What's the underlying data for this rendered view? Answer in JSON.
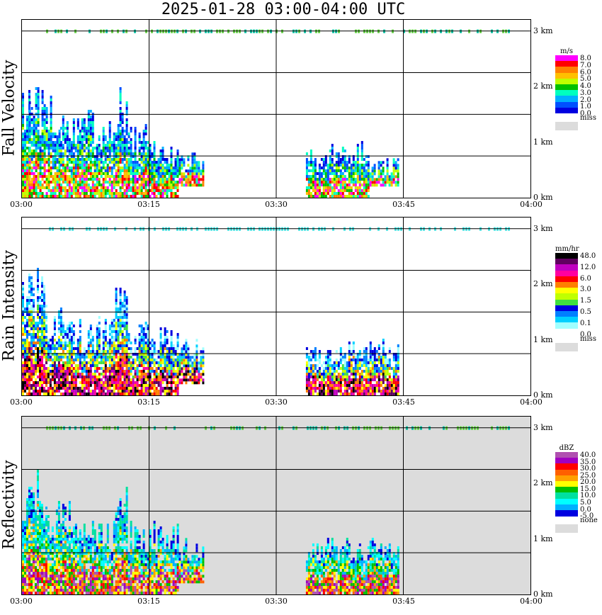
{
  "title": "2025-01-28   03:00-04:00 UTC",
  "chart_data": [
    {
      "type": "heatmap",
      "ylabel": "Fall Velocity",
      "x_tick_labels": [
        "03:00",
        "03:15",
        "03:30",
        "03:45",
        "04:00"
      ],
      "y_tick_labels": [
        "0 km",
        "1 km",
        "2 km",
        "3 km"
      ],
      "xlim": [
        "03:00",
        "04:00"
      ],
      "ylim_km": [
        0,
        3.2
      ],
      "grid": true,
      "legend": {
        "unit": "m/s",
        "entries": [
          "8.0",
          "7.0",
          "6.0",
          "5.0",
          "4.0",
          "3.0",
          "2.0",
          "1.0",
          "0.0",
          "miss"
        ],
        "colors": [
          "#ff00ff",
          "#ff0000",
          "#ff8000",
          "#ffc000",
          "#c0ff00",
          "#00c000",
          "#00ffc0",
          "#00b0ff",
          "#0050ff",
          "#0000e0",
          "#dcdcdc"
        ]
      },
      "background": "#ffffff",
      "echoes": [
        {
          "t0": 0.0,
          "t1": 0.8,
          "h0": 0.0,
          "h1": 2.2
        },
        {
          "t0": 0.8,
          "t1": 4.5,
          "h0": 0.0,
          "h1": 2.0
        },
        {
          "t0": 4.5,
          "t1": 8.5,
          "h0": 0.0,
          "h1": 1.6
        },
        {
          "t0": 8.5,
          "t1": 11.5,
          "h0": 0.0,
          "h1": 1.4
        },
        {
          "t0": 11.5,
          "t1": 12.5,
          "h0": 0.0,
          "h1": 2.1
        },
        {
          "t0": 12.5,
          "t1": 15.0,
          "h0": 0.0,
          "h1": 1.3
        },
        {
          "t0": 15.0,
          "t1": 18.5,
          "h0": 0.0,
          "h1": 1.0
        },
        {
          "t0": 18.5,
          "t1": 21.5,
          "h0": 0.2,
          "h1": 0.8
        },
        {
          "t0": 33.5,
          "t1": 35.5,
          "h0": 0.0,
          "h1": 0.9
        },
        {
          "t0": 35.5,
          "t1": 41.0,
          "h0": 0.0,
          "h1": 1.0
        },
        {
          "t0": 41.0,
          "t1": 44.5,
          "h0": 0.2,
          "h1": 0.7
        }
      ],
      "top_band_km": 3.0
    },
    {
      "type": "heatmap",
      "ylabel": "Rain Intensity",
      "x_tick_labels": [
        "03:00",
        "03:15",
        "03:30",
        "03:45",
        "04:00"
      ],
      "y_tick_labels": [
        "0 km",
        "1 km",
        "2 km",
        "3 km"
      ],
      "xlim": [
        "03:00",
        "04:00"
      ],
      "ylim_km": [
        0,
        3.2
      ],
      "grid": true,
      "legend": {
        "unit": "mm/hr",
        "entries": [
          "48.0",
          "12.0",
          "6.0",
          "3.0",
          "1.5",
          "0.5",
          "0.1",
          "0.0",
          "miss"
        ],
        "colors": [
          "#000000",
          "#600060",
          "#c000c0",
          "#ff00a0",
          "#ff0000",
          "#ff8000",
          "#ffff00",
          "#c0ff00",
          "#40e040",
          "#0000e0",
          "#0080ff",
          "#00d0ff",
          "#a0ffff",
          "#ffffff",
          "#dcdcdc"
        ]
      },
      "background": "#ffffff",
      "echoes": [
        {
          "t0": 0.0,
          "t1": 3.0,
          "h0": 0.0,
          "h1": 2.3
        },
        {
          "t0": 3.0,
          "t1": 6.0,
          "h0": 0.0,
          "h1": 1.6
        },
        {
          "t0": 6.0,
          "t1": 11.0,
          "h0": 0.0,
          "h1": 1.4
        },
        {
          "t0": 11.0,
          "t1": 12.5,
          "h0": 0.0,
          "h1": 2.1
        },
        {
          "t0": 12.5,
          "t1": 18.5,
          "h0": 0.0,
          "h1": 1.3
        },
        {
          "t0": 18.5,
          "t1": 21.5,
          "h0": 0.2,
          "h1": 1.0
        },
        {
          "t0": 33.5,
          "t1": 36.0,
          "h0": 0.0,
          "h1": 0.9
        },
        {
          "t0": 36.0,
          "t1": 44.5,
          "h0": 0.0,
          "h1": 1.0
        }
      ],
      "top_band_km": 3.0
    },
    {
      "type": "heatmap",
      "ylabel": "Reflectivity",
      "x_tick_labels": [
        "03:00",
        "03:15",
        "03:30",
        "03:45",
        "04:00"
      ],
      "y_tick_labels": [
        "0 km",
        "1 km",
        "2 km",
        "3 km"
      ],
      "xlim": [
        "03:00",
        "04:00"
      ],
      "ylim_km": [
        0,
        3.2
      ],
      "grid": true,
      "legend": {
        "unit": "dBZ",
        "entries": [
          "40.0",
          "35.0",
          "30.0",
          "25.0",
          "20.0",
          "15.0",
          "10.0",
          "5.0",
          "0.0",
          "-5.0",
          "none"
        ],
        "colors": [
          "#b050b0",
          "#a000c0",
          "#ff0000",
          "#ff6000",
          "#ffa000",
          "#ffff00",
          "#00c000",
          "#00e0a0",
          "#00ffff",
          "#00b0ff",
          "#0000e0",
          "#dcdcdc"
        ]
      },
      "background": "#dcdcdc",
      "echoes": [
        {
          "t0": 0.0,
          "t1": 3.0,
          "h0": 0.0,
          "h1": 2.3
        },
        {
          "t0": 3.0,
          "t1": 6.5,
          "h0": 0.0,
          "h1": 1.8
        },
        {
          "t0": 6.5,
          "t1": 11.0,
          "h0": 0.0,
          "h1": 1.4
        },
        {
          "t0": 11.0,
          "t1": 12.5,
          "h0": 0.0,
          "h1": 2.1
        },
        {
          "t0": 12.5,
          "t1": 18.5,
          "h0": 0.0,
          "h1": 1.3
        },
        {
          "t0": 18.5,
          "t1": 21.5,
          "h0": 0.2,
          "h1": 1.0
        },
        {
          "t0": 33.5,
          "t1": 36.0,
          "h0": 0.0,
          "h1": 0.9
        },
        {
          "t0": 36.0,
          "t1": 44.5,
          "h0": 0.0,
          "h1": 1.0
        }
      ],
      "top_band_km": 3.0
    }
  ]
}
